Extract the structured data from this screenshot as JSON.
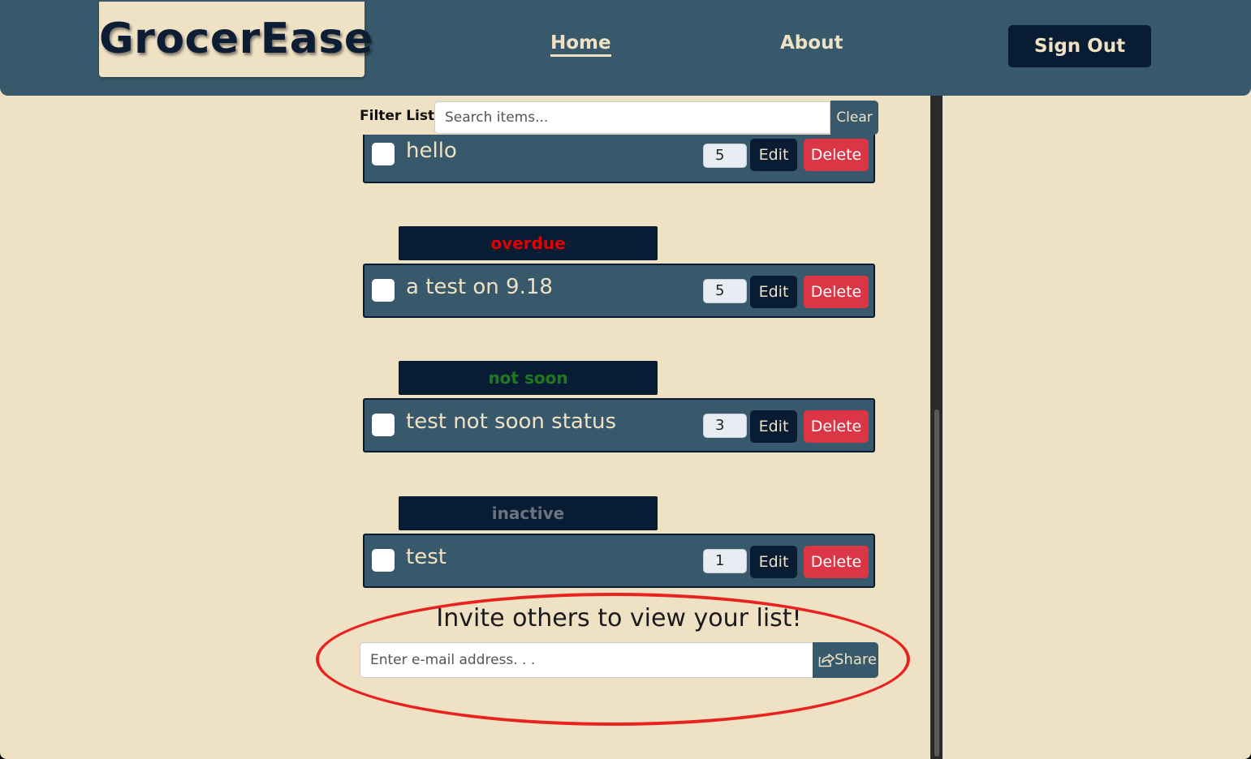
{
  "app": {
    "name": "GrocerEase"
  },
  "nav": {
    "home_label": "Home",
    "about_label": "About",
    "signout_label": "Sign Out"
  },
  "filter": {
    "label": "Filter List:",
    "placeholder": "Search items...",
    "clear_label": "Clear"
  },
  "items": [
    {
      "status": "",
      "name": "hello",
      "quantity": "5",
      "edit_label": "Edit",
      "delete_label": "Delete"
    },
    {
      "status": "overdue",
      "status_color": "#e00000",
      "name": "a test on 9.18",
      "quantity": "5",
      "edit_label": "Edit",
      "delete_label": "Delete"
    },
    {
      "status": "not soon",
      "status_color": "#1f7a1f",
      "name": "test not soon status",
      "quantity": "3",
      "edit_label": "Edit",
      "delete_label": "Delete"
    },
    {
      "status": "inactive",
      "status_color": "#6b7280",
      "name": "test",
      "quantity": "1",
      "edit_label": "Edit",
      "delete_label": "Delete"
    }
  ],
  "invite": {
    "title": "Invite others to view your list!",
    "placeholder": "Enter e-mail address. . .",
    "share_label": "Share",
    "share_icon": "share-icon"
  },
  "colors": {
    "background": "#efe1c4",
    "navbar": "#37596b",
    "dark": "#081c33",
    "delete": "#dc3545",
    "highlight": "#e8231f"
  }
}
